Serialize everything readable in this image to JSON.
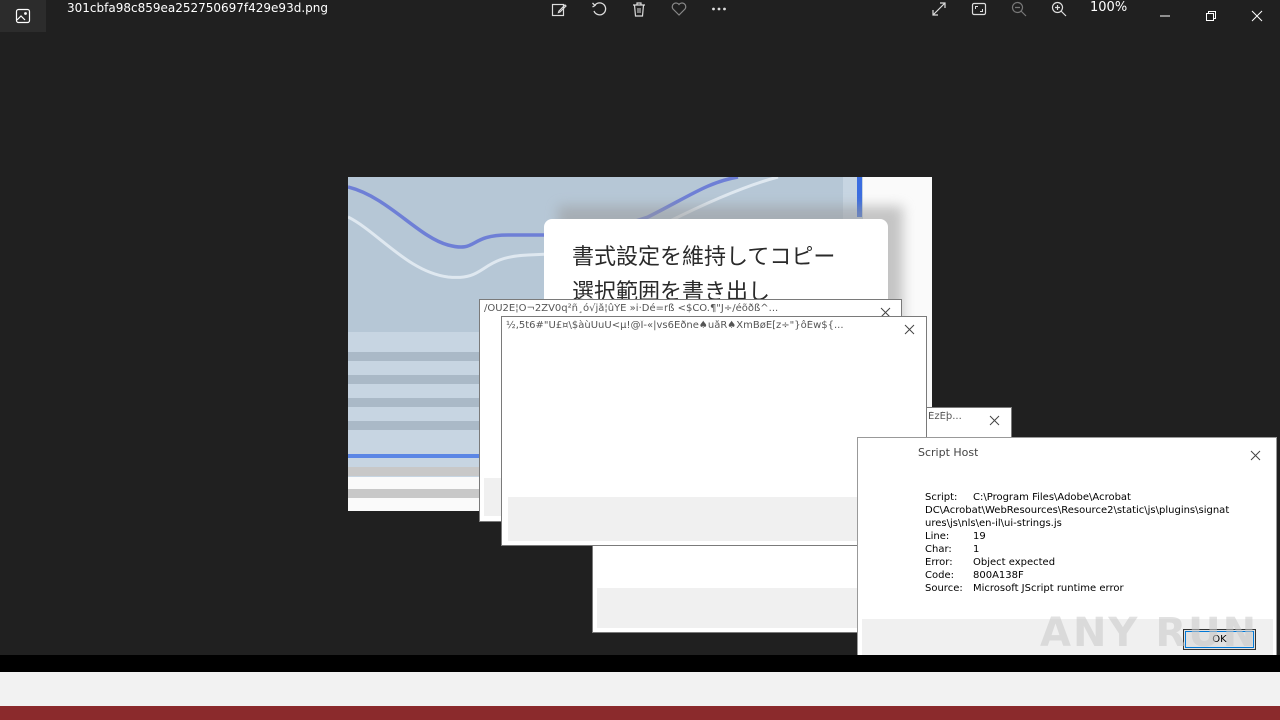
{
  "window": {
    "filename": "301cbfa98c859ea252750697f429e93d.png",
    "zoom": "100%"
  },
  "toolbar": {
    "icons": [
      "edit-image-icon",
      "rotate-icon",
      "delete-icon",
      "favorite-icon",
      "more-icon"
    ],
    "right_icons": [
      "fullscreen-icon",
      "fit-icon",
      "zoom-out-icon",
      "zoom-in-icon"
    ]
  },
  "splash": {
    "line1": "書式設定を維持してコピー",
    "line2": "選択範囲を書き出し"
  },
  "dialogs": {
    "garbled1_title": "/OÙ2E¦Ò¬2ZV0q²ñ¸ó√jå¦ûÝE »i·Dé=rß <$CÖ.¶\"J÷/éõðß^...",
    "garbled2_title": "½,5t6#\"Ü£¤\\$àùÛuÜ<µ!@Î-«|vs6Ëðne♠uåR♠XmBøE[z÷\"}ôÉw${...",
    "garbled3_title": "ÉzÉþ...",
    "script_host": {
      "title": "Script Host",
      "rows": [
        {
          "k": "Script:",
          "v": "C:\\Program Files\\Adobe\\Acrobat"
        },
        {
          "k": "",
          "v": "DC\\Acrobat\\WebResources\\Resource2\\static\\js\\plugins\\signat"
        },
        {
          "k": "",
          "v": "ures\\js\\nls\\en-il\\ui-strings.js"
        },
        {
          "k": "Line:",
          "v": "19"
        },
        {
          "k": "Char:",
          "v": "1"
        },
        {
          "k": "Error:",
          "v": "Object expected"
        },
        {
          "k": "Code:",
          "v": "800A138F"
        },
        {
          "k": "Source:",
          "v": "Microsoft JScript runtime error"
        }
      ],
      "ok": "OK"
    }
  },
  "watermark": "ANY RUN"
}
